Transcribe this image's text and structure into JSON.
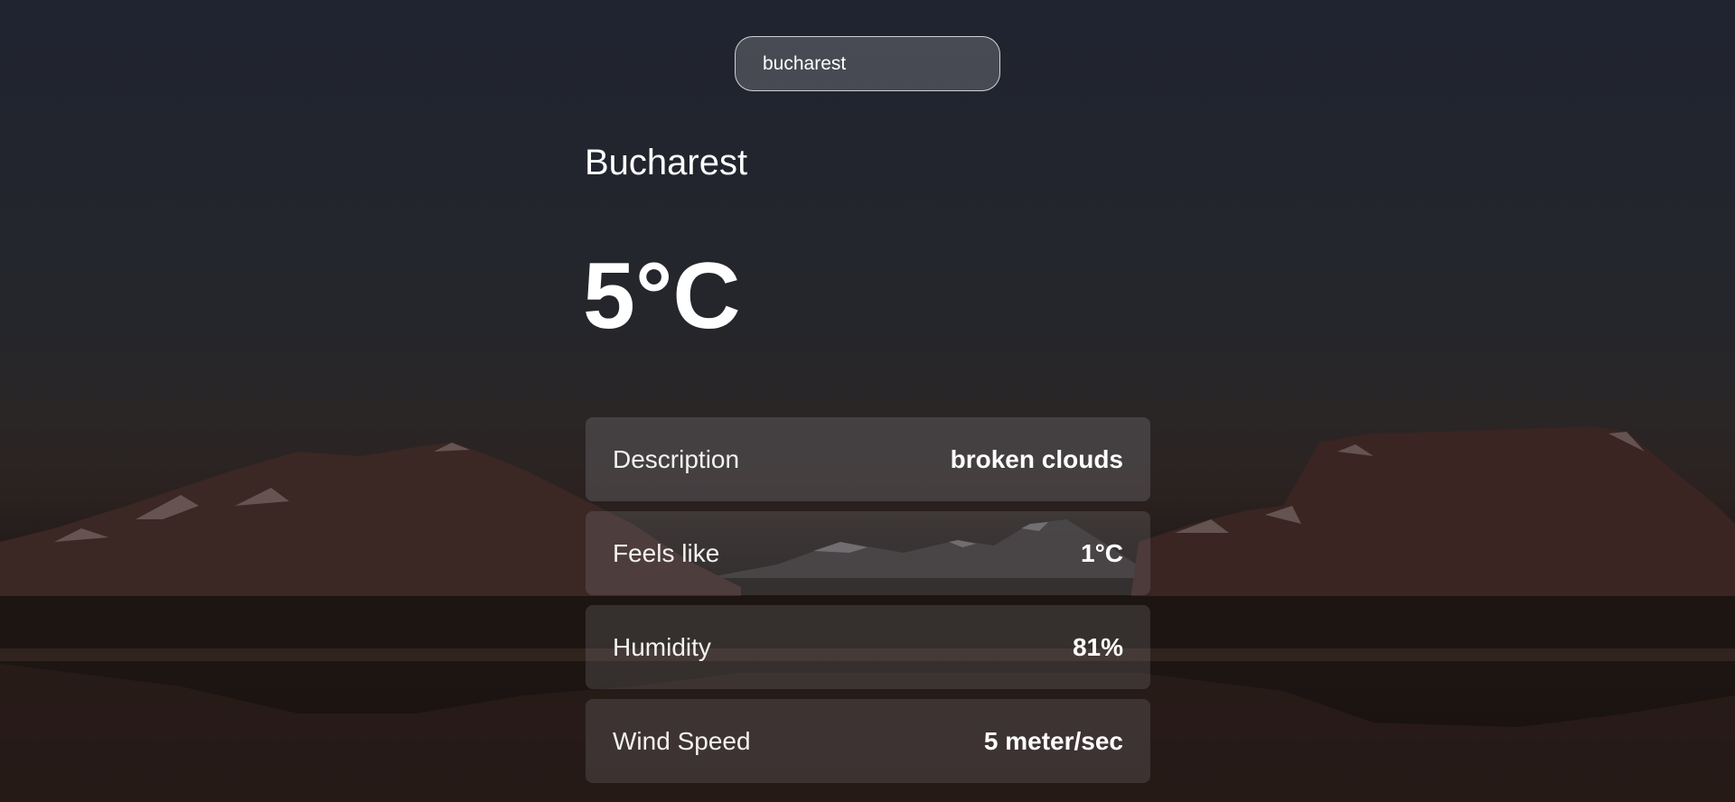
{
  "search": {
    "value": "bucharest"
  },
  "weather": {
    "city": "Bucharest",
    "temperature": "5°C",
    "details": [
      {
        "label": "Description",
        "value": "broken clouds"
      },
      {
        "label": "Feels like",
        "value": "1°C"
      },
      {
        "label": "Humidity",
        "value": "81%"
      },
      {
        "label": "Wind Speed",
        "value": "5 meter/sec"
      }
    ]
  },
  "colors": {
    "background_top": "#202430",
    "mountain": "#3a2622",
    "text": "#ffffff"
  }
}
